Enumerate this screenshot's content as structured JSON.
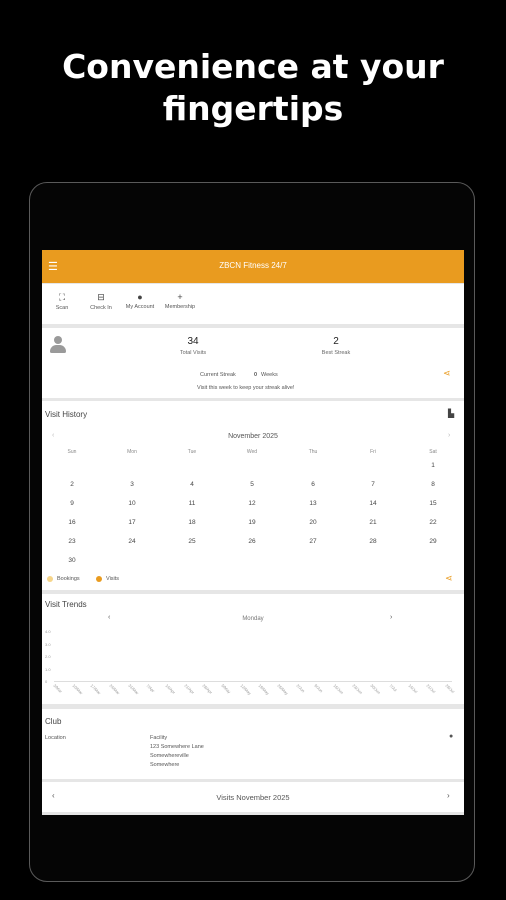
{
  "headline": {
    "line1": "Convenience at your",
    "line2": "fingertips"
  },
  "app": {
    "title": "ZBCN Fitness 24/7"
  },
  "quick_actions": [
    {
      "icon": "scan-icon",
      "label": "Scan"
    },
    {
      "icon": "check-in-icon",
      "label": "Check In"
    },
    {
      "icon": "person-icon",
      "label": "My Account"
    },
    {
      "icon": "plus-icon",
      "label": "Membership"
    }
  ],
  "stats": {
    "total_visits": "34",
    "total_visits_label": "Total Visits",
    "best_streak": "2",
    "best_streak_label": "Best Streak",
    "current_streak_label": "Current Streak",
    "current_streak_value": "0",
    "current_streak_unit": "Weeks",
    "message": "Visit this week to keep your streak alive!"
  },
  "visit_history": {
    "title": "Visit History",
    "month": "November 2025",
    "weekdays": [
      "Sun",
      "Mon",
      "Tue",
      "Wed",
      "Thu",
      "Fri",
      "Sat"
    ],
    "start_weekday": 6,
    "days": 30,
    "legend": {
      "bookings": "Bookings",
      "visits": "Visits"
    }
  },
  "visit_trends": {
    "title": "Visit Trends",
    "selector": "Monday",
    "y_ticks": [
      "0",
      "1.0",
      "2.0",
      "3.0",
      "4.0"
    ],
    "x_ticks": [
      "3/Mar",
      "10/Mar",
      "17/Mar",
      "24/Mar",
      "31/Mar",
      "7/Apr",
      "14/Apr",
      "21/Apr",
      "28/Apr",
      "5/May",
      "12/May",
      "19/May",
      "26/May",
      "2/Jun",
      "9/Jun",
      "16/Jun",
      "23/Jun",
      "30/Jun",
      "7/Jul",
      "14/Jul",
      "21/Jul",
      "28/Jul"
    ]
  },
  "club": {
    "title": "Club",
    "location_label": "Location",
    "facility": "Facility",
    "street": "123 Somewhere Lane",
    "city": "Somewhereville",
    "region": "Somewhere"
  },
  "footer": {
    "label": "Visits November 2025"
  },
  "colors": {
    "accent": "#e99b1f",
    "bookings": "#f6d58a",
    "visits": "#e99b1f"
  }
}
